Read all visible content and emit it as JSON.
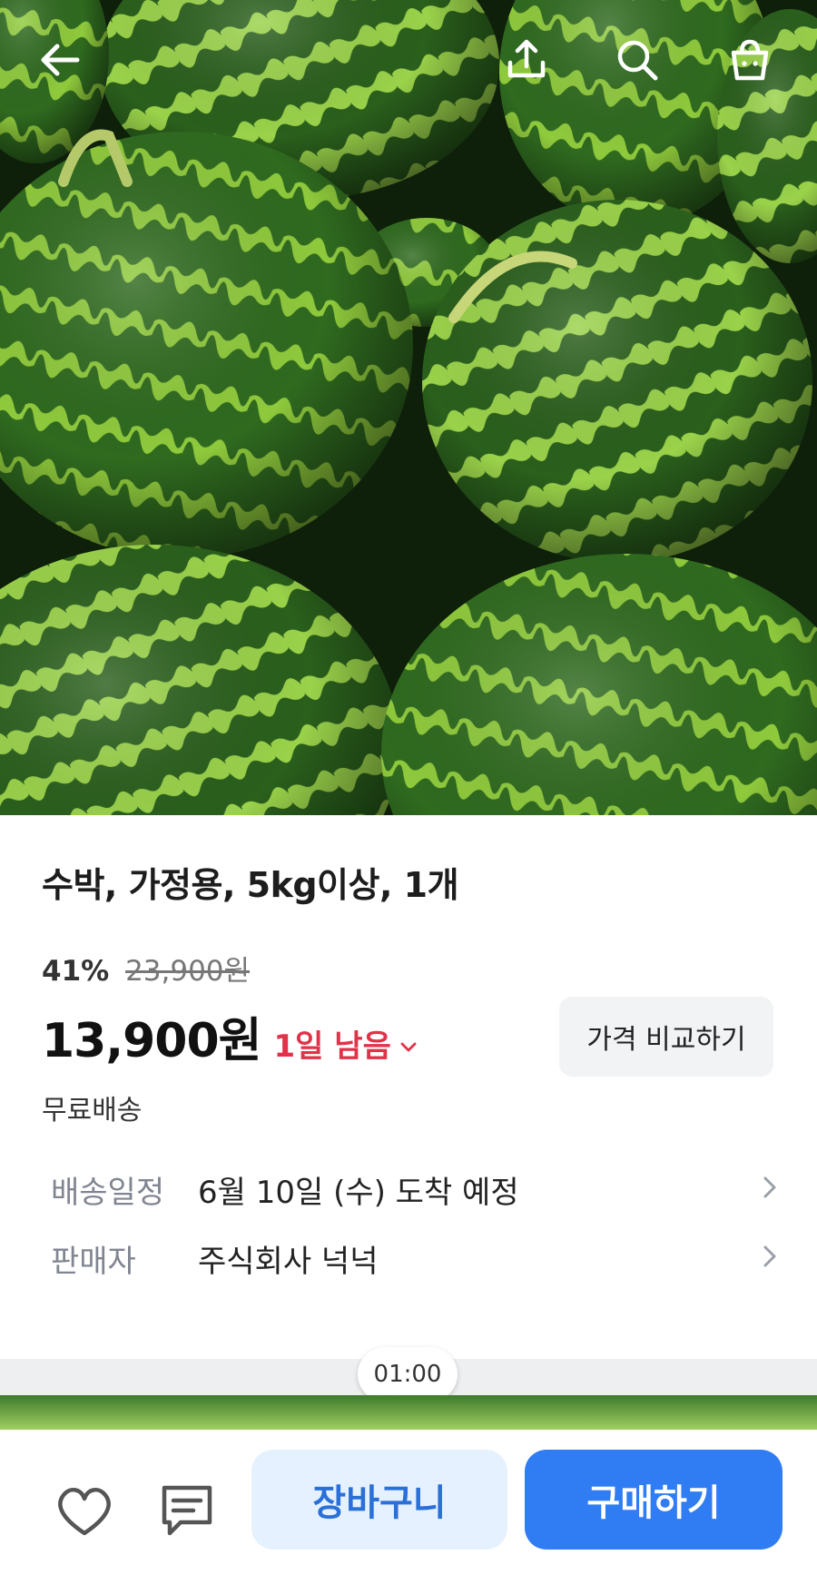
{
  "hero": {
    "image_alt": "watermelons"
  },
  "topbar": {
    "icons": [
      "back-arrow-icon",
      "share-icon",
      "search-icon",
      "cart-bag-icon"
    ]
  },
  "product": {
    "title": "수박, 가정용, 5kg이상, 1개",
    "discount_rate": "41%",
    "original_price": "23,900원",
    "sale_price": "13,900원",
    "time_left": "1일 남음",
    "compare_label": "가격 비교하기",
    "shipping": "무료배송"
  },
  "details": [
    {
      "label": "배송일정",
      "value": "6월 10일 (수) 도착 예정"
    },
    {
      "label": "판매자",
      "value": "주식회사 넉넉"
    }
  ],
  "video_timer": "01:00",
  "bottom_bar": {
    "cart_label": "장바구니",
    "buy_label": "구매하기",
    "icons": [
      "heart-icon",
      "chat-icon"
    ]
  },
  "colors": {
    "accent_blue": "#2f7cf3",
    "cart_bg": "#e6f1ff",
    "countdown_red": "#e0334a"
  }
}
